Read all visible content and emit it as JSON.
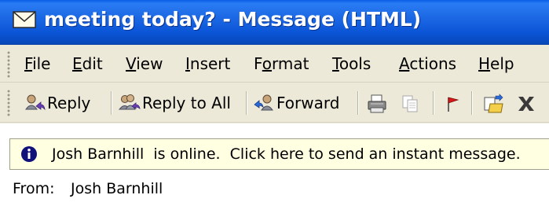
{
  "window": {
    "title": "meeting today? - Message (HTML)",
    "title_icon": "envelope-icon"
  },
  "menu": {
    "items": [
      {
        "label": "File",
        "accel": "F"
      },
      {
        "label": "Edit",
        "accel": "E"
      },
      {
        "label": "View",
        "accel": "V"
      },
      {
        "label": "Insert",
        "accel": "I"
      },
      {
        "label": "Format",
        "accel": "o"
      },
      {
        "label": "Tools",
        "accel": "T"
      },
      {
        "label": "Actions",
        "accel": "A"
      },
      {
        "label": "Help",
        "accel": "H"
      }
    ]
  },
  "toolbar": {
    "reply_label": "Reply",
    "reply_all_label": "Reply to All",
    "forward_label": "Forward",
    "icons": [
      "reply-icon",
      "reply-all-icon",
      "forward-icon",
      "print-icon",
      "copy-icon",
      "flag-icon",
      "move-to-folder-icon",
      "delete-icon"
    ]
  },
  "infobar": {
    "text": "Josh Barnhill  is online.  Click here to send an instant message.",
    "icon": "info-icon"
  },
  "header": {
    "from_label": "From:",
    "from_value": "Josh Barnhill"
  },
  "colors": {
    "titlebar": "#0a54d6",
    "chrome": "#ece9d8",
    "infobar": "#ffffe1"
  }
}
